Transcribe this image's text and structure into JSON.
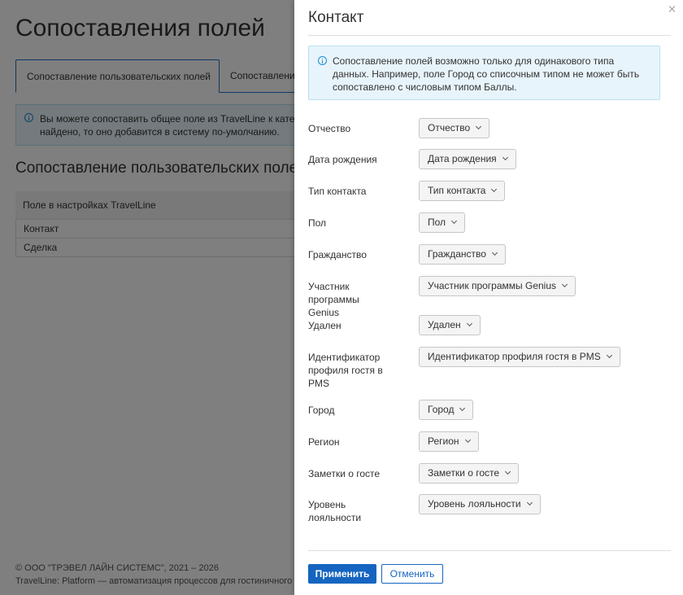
{
  "background": {
    "page_title": "Сопоставления полей",
    "tabs": [
      {
        "label": "Сопоставление пользовательских полей"
      },
      {
        "label": "Сопоставлени"
      }
    ],
    "info_lines": [
      "Вы можете сопоставить общее поле из TravelLine к катего",
      "найдено, то оно добавится в систему по-умолчанию."
    ],
    "section_title": "Сопоставление пользовательских полей",
    "table_header": "Поле в настройках TravelLine",
    "table_rows": [
      "Контакт",
      "Сделка"
    ],
    "footer_line1": "© ООО \"ТРЭВЕЛ ЛАЙН СИСТЕМС\", 2021 – 2026",
    "footer_line2": "TravelLine: Platform — автоматизация процессов для гостиничного бизне"
  },
  "drawer": {
    "title": "Контакт",
    "info_text": "Сопоставление полей возможно только для одинакового типа данных. Например, поле Город со списочным типом не может быть сопоставлено с числовым типом Баллы.",
    "fields": [
      {
        "label": "Отчество",
        "value": "Отчество"
      },
      {
        "label": "Дата рождения",
        "value": "Дата рождения"
      },
      {
        "label": "Тип контакта",
        "value": "Тип контакта"
      },
      {
        "label": "Пол",
        "value": "Пол"
      },
      {
        "label": "Гражданство",
        "value": "Гражданство"
      },
      {
        "label": "Участник программы Genius",
        "value": "Участник программы Genius"
      },
      {
        "label": "Удален",
        "value": "Удален"
      },
      {
        "label": "Идентификатор профиля гостя в PMS",
        "value": "Идентификатор профиля гостя в PMS"
      },
      {
        "label": "Город",
        "value": "Город"
      },
      {
        "label": "Регион",
        "value": "Регион"
      },
      {
        "label": "Заметки о госте",
        "value": "Заметки о госте"
      },
      {
        "label": "Уровень лояльности",
        "value": "Уровень лояльности"
      }
    ],
    "apply_label": "Применить",
    "cancel_label": "Отменить"
  },
  "colors": {
    "primary": "#1565c0",
    "info_bg": "#e8f4fb",
    "overlay": "rgba(0,0,0,0.5)"
  }
}
